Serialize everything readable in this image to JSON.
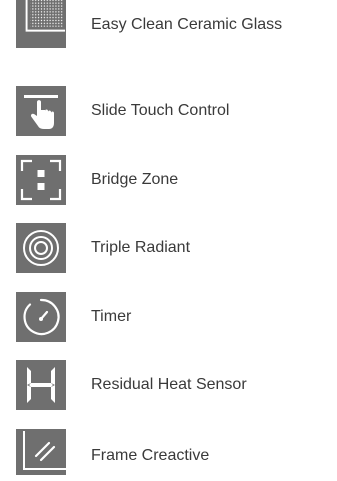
{
  "features": [
    {
      "label": "Easy Clean Ceramic Glass",
      "icon": "ceramic-glass-icon"
    },
    {
      "label": "Slide Touch Control",
      "icon": "slide-touch-icon"
    },
    {
      "label": "Bridge Zone",
      "icon": "bridge-zone-icon"
    },
    {
      "label": "Triple Radiant",
      "icon": "triple-radiant-icon"
    },
    {
      "label": "Timer",
      "icon": "timer-icon"
    },
    {
      "label": "Residual Heat Sensor",
      "icon": "residual-heat-icon"
    },
    {
      "label": "Frame Creactive",
      "icon": "frame-icon"
    }
  ],
  "colors": {
    "tile": "#6f6f6f",
    "icon": "#ffffff",
    "text": "#3a3a3a"
  }
}
